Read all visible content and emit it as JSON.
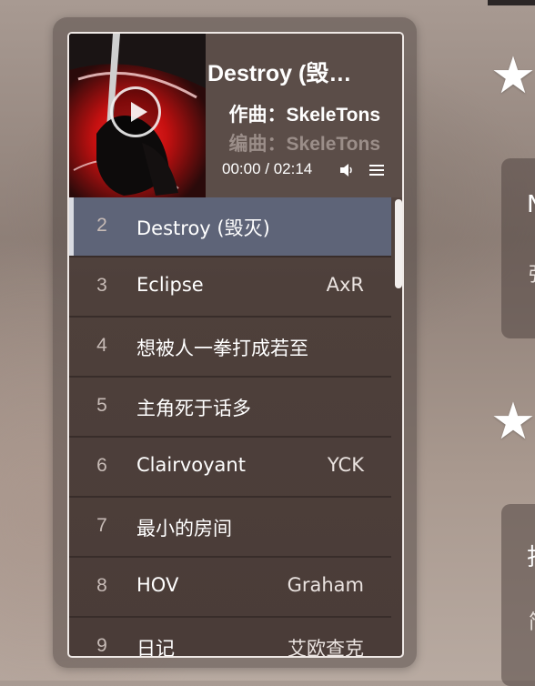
{
  "player": {
    "title": "Destroy (毁…",
    "composer": "作曲：SkeleTons",
    "arranger": "编曲：SkeleTons",
    "current_time": "00:00",
    "duration": "02:14",
    "time_display": "00:00 / 02:14",
    "icons": {
      "play": "play-icon",
      "volume": "volume-icon",
      "menu": "menu-icon"
    }
  },
  "playlist": {
    "tracks": [
      {
        "num": "2",
        "name": "Destroy (毁灭)",
        "artist": "",
        "active": true
      },
      {
        "num": "3",
        "name": "Eclipse",
        "artist": "AxR",
        "active": false
      },
      {
        "num": "4",
        "name": "想被人一拳打成若至",
        "artist": "",
        "active": false
      },
      {
        "num": "5",
        "name": "主角死于话多",
        "artist": "",
        "active": false
      },
      {
        "num": "6",
        "name": "Clairvoyant",
        "artist": "YCK",
        "active": false
      },
      {
        "num": "7",
        "name": "最小的房间",
        "artist": "",
        "active": false
      },
      {
        "num": "8",
        "name": "HOV",
        "artist": "Graham",
        "active": false
      },
      {
        "num": "9",
        "name": "日记",
        "artist": "艾欧查克",
        "active": false
      }
    ]
  },
  "side": {
    "card1_title": "N",
    "card1_text": "强",
    "card2_title": "找",
    "card2_text": "简",
    "star_icon": "star-icon"
  },
  "colors": {
    "active_row": "#5e6478",
    "accent_white": "#ffffff",
    "muted_text": "#9b8e89"
  }
}
